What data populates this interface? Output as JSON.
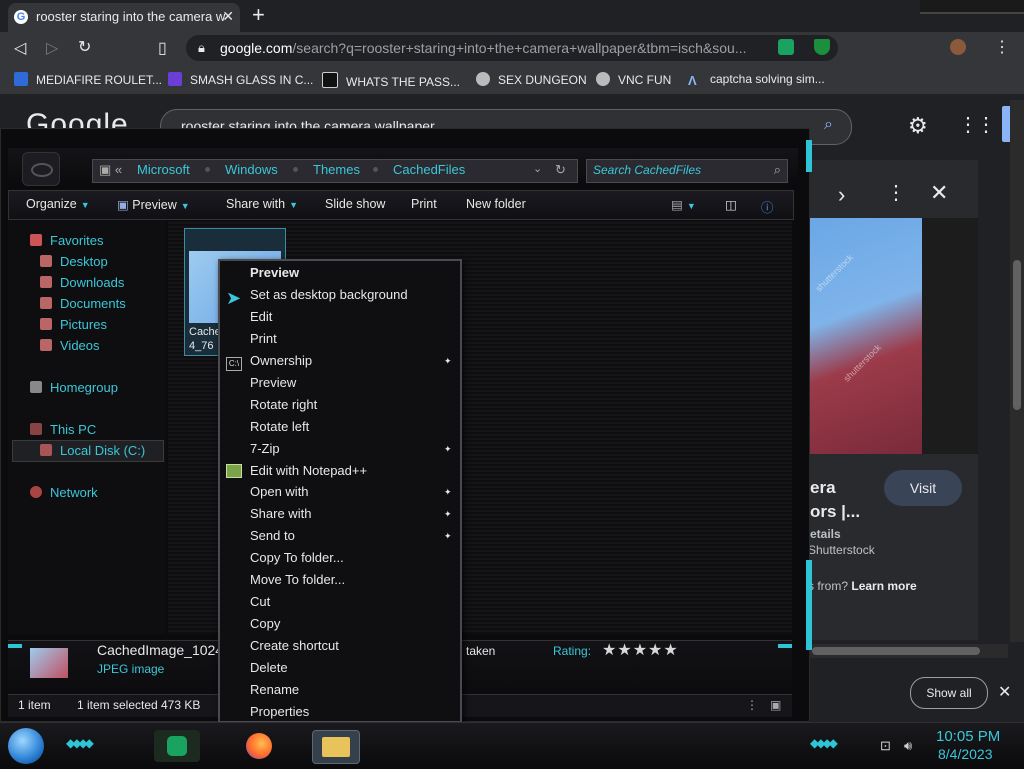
{
  "browser": {
    "tab_title": "rooster staring into the camera wa",
    "tab_favicon": "G",
    "new_tab": "+",
    "url_host": "google.com",
    "url_rest": "/search?q=rooster+staring+into+the+camera+wallpaper&tbm=isch&sou...",
    "bookmarks": [
      {
        "label": "MEDIAFIRE ROULET...",
        "color": "#2f6ad8"
      },
      {
        "label": "SMASH GLASS IN C...",
        "color": "#6a3fd8"
      },
      {
        "label": "WHATS THE PASS...",
        "color": "#e8e8e8"
      },
      {
        "label": "SEX DUNGEON",
        "color": "#d0d0d0"
      },
      {
        "label": "VNC FUN",
        "color": "#d0d0d0"
      },
      {
        "label": "captcha solving sim...",
        "color": "#8ab4f8"
      }
    ]
  },
  "google": {
    "logo": "Google",
    "query": "rooster staring into the camera wallpaper",
    "panel_title_line1": "era",
    "panel_title_line2": "ors |...",
    "visit_label": "Visit",
    "details_label": "etails",
    "source_label": "Shutterstock",
    "learn_prefix": "s from?",
    "learn_link": "Learn more",
    "watermark": "shutterstock",
    "show_all": "Show all"
  },
  "explorer": {
    "breadcrumbs": [
      "Microsoft",
      "Windows",
      "Themes",
      "CachedFiles"
    ],
    "search_placeholder": "Search CachedFiles",
    "commands": {
      "organize": "Organize",
      "preview": "Preview",
      "share_with": "Share with",
      "slide_show": "Slide show",
      "print": "Print",
      "new_folder": "New folder"
    },
    "nav": {
      "favorites": "Favorites",
      "desktop": "Desktop",
      "downloads": "Downloads",
      "documents": "Documents",
      "pictures": "Pictures",
      "videos": "Videos",
      "homegroup": "Homegroup",
      "this_pc": "This PC",
      "local_disk": "Local Disk (C:)",
      "network": "Network"
    },
    "thumb_caption_1": "Cache",
    "thumb_caption_2": "4_76",
    "details": {
      "name": "CachedImage_1024",
      "type": "JPEG image",
      "taken": "taken",
      "rating_label": "Rating:",
      "stars": "★★★★★"
    },
    "status": {
      "items": "1 item",
      "selected": "1 item selected",
      "size": "473 KB"
    }
  },
  "context_menu": {
    "items": [
      {
        "label": "Preview",
        "bold": true,
        "submenu": false
      },
      {
        "label": "Set as desktop background",
        "bold": false,
        "submenu": false
      },
      {
        "label": "Edit",
        "bold": false,
        "submenu": false
      },
      {
        "label": "Print",
        "bold": false,
        "submenu": false
      },
      {
        "label": "Ownership",
        "bold": false,
        "submenu": true
      },
      {
        "label": "Preview",
        "bold": false,
        "submenu": false
      },
      {
        "label": "Rotate right",
        "bold": false,
        "submenu": false
      },
      {
        "label": "Rotate left",
        "bold": false,
        "submenu": false
      },
      {
        "label": "7-Zip",
        "bold": false,
        "submenu": true
      },
      {
        "label": "Edit with Notepad++",
        "bold": false,
        "submenu": false
      },
      {
        "label": "Open with",
        "bold": false,
        "submenu": true
      },
      {
        "label": "Share with",
        "bold": false,
        "submenu": true
      },
      {
        "label": "Send to",
        "bold": false,
        "submenu": true
      },
      {
        "label": "Copy To folder...",
        "bold": false,
        "submenu": false
      },
      {
        "label": "Move To folder...",
        "bold": false,
        "submenu": false
      },
      {
        "label": "Cut",
        "bold": false,
        "submenu": false
      },
      {
        "label": "Copy",
        "bold": false,
        "submenu": false
      },
      {
        "label": "Create shortcut",
        "bold": false,
        "submenu": false
      },
      {
        "label": "Delete",
        "bold": false,
        "submenu": false
      },
      {
        "label": "Rename",
        "bold": false,
        "submenu": false
      },
      {
        "label": "Properties",
        "bold": false,
        "submenu": false
      }
    ]
  },
  "taskbar": {
    "time": "10:05 PM",
    "date": "8/4/2023"
  },
  "colors": {
    "accent": "#3bc7d8",
    "chrome_bg": "#202124"
  }
}
